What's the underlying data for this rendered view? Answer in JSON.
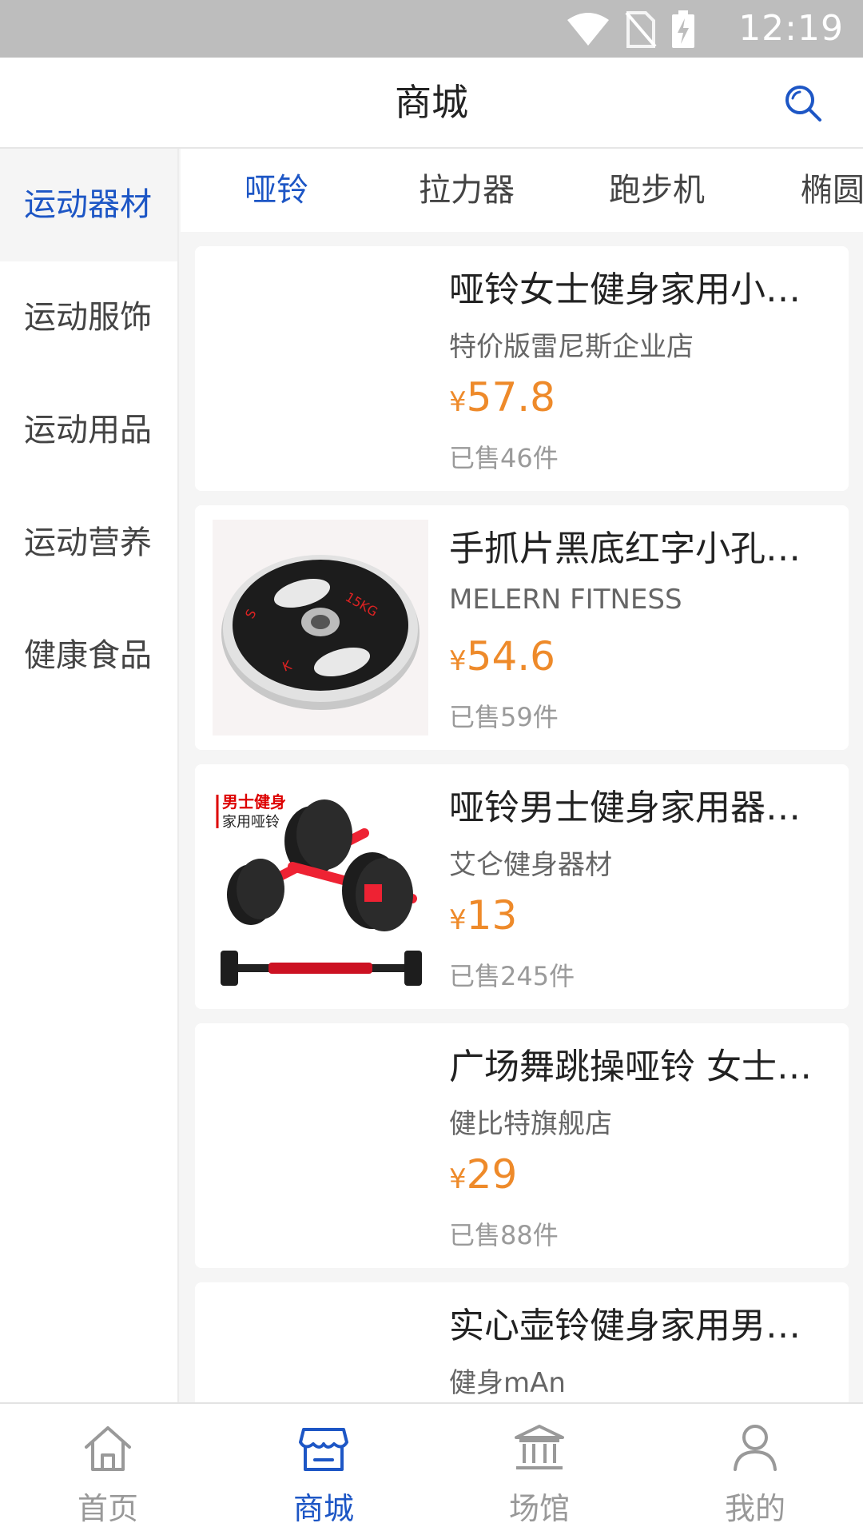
{
  "status_bar": {
    "time": "12:19"
  },
  "header": {
    "title": "商城"
  },
  "sidebar": {
    "items": [
      {
        "label": "运动器材",
        "active": true
      },
      {
        "label": "运动服饰"
      },
      {
        "label": "运动用品"
      },
      {
        "label": "运动营养"
      },
      {
        "label": "健康食品"
      }
    ]
  },
  "tabs": [
    {
      "label": "哑铃",
      "active": true
    },
    {
      "label": "拉力器"
    },
    {
      "label": "跑步机"
    },
    {
      "label": "椭圆"
    }
  ],
  "products": [
    {
      "name": "哑铃女士健身家用小…",
      "store": "特价版雷尼斯企业店",
      "currency": "¥",
      "price": "57.8",
      "sold": "已售46件",
      "image": "none"
    },
    {
      "name": "手抓片黑底红字小孔…",
      "store": "MELERN FITNESS",
      "currency": "¥",
      "price": "54.6",
      "sold": "已售59件",
      "image": "weight-plate"
    },
    {
      "name": "哑铃男士健身家用器…",
      "store": "艾仑健身器材",
      "currency": "¥",
      "price": "13",
      "sold": "已售245件",
      "image": "dumbbell-set",
      "image_text": [
        "男士健身",
        "家用哑铃"
      ]
    },
    {
      "name": "广场舞跳操哑铃 女士…",
      "store": "健比特旗舰店",
      "currency": "¥",
      "price": "29",
      "sold": "已售88件",
      "image": "none"
    },
    {
      "name": "实心壶铃健身家用男…",
      "store": "健身mAn",
      "currency": "¥",
      "price": "",
      "sold": "",
      "image": "none"
    }
  ],
  "bottom_nav": {
    "items": [
      {
        "label": "首页",
        "icon": "home-icon"
      },
      {
        "label": "商城",
        "icon": "store-icon",
        "active": true
      },
      {
        "label": "场馆",
        "icon": "venue-icon"
      },
      {
        "label": "我的",
        "icon": "profile-icon"
      }
    ]
  },
  "colors": {
    "accent": "#1d56c5",
    "price": "#ee8a2a",
    "status_bar": "#bdbdbd"
  }
}
